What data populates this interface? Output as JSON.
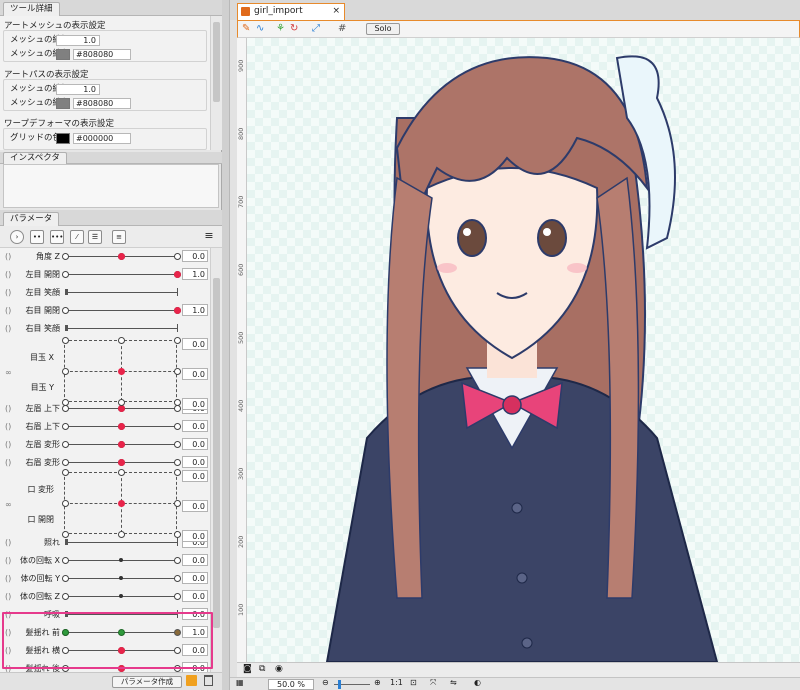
{
  "tool_details": {
    "tab": "ツール詳細",
    "sections": [
      {
        "title": "アートメッシュの表示設定",
        "rows": [
          {
            "label": "メッシュの線幅",
            "value": "1.0"
          },
          {
            "label": "メッシュの線色",
            "color": "#808080",
            "hex": "#808080"
          }
        ]
      },
      {
        "title": "アートパスの表示設定",
        "rows": [
          {
            "label": "メッシュの線幅",
            "value": "1.0"
          },
          {
            "label": "メッシュの線色",
            "color": "#808080",
            "hex": "#808080"
          }
        ]
      },
      {
        "title": "ワープデフォーマの表示設定",
        "rows": [
          {
            "label": "グリッドの色",
            "color": "#000000",
            "hex": "#000000"
          }
        ]
      }
    ]
  },
  "inspector": {
    "tab": "インスペクタ"
  },
  "parameter": {
    "tab": "パラメータ",
    "menu_icon": "hamburger-menu-icon",
    "create_button": "パラメータ作成",
    "rows": [
      {
        "name": "角度 Z",
        "value": "0.0",
        "pos": 0.5,
        "type": "red",
        "ticks": [
          0.5
        ]
      },
      {
        "name": "左目 開閉",
        "value": "1.0",
        "pos": 1.0,
        "type": "red",
        "ticks": []
      },
      {
        "name": "左目 笑顔",
        "value": "",
        "pos": 0,
        "type": "arrow",
        "ticks": []
      },
      {
        "name": "右目 開閉",
        "value": "1.0",
        "pos": 1.0,
        "type": "red",
        "ticks": []
      },
      {
        "name": "右目 笑顔",
        "value": "",
        "pos": 0,
        "type": "arrow",
        "ticks": []
      },
      {
        "name": "左眉 上下",
        "value": "0.0",
        "pos": 0.5,
        "type": "red",
        "ticks": [
          0.5
        ]
      },
      {
        "name": "右眉 上下",
        "value": "0.0",
        "pos": 0.5,
        "type": "red",
        "ticks": [
          0.5
        ]
      },
      {
        "name": "左眉 変形",
        "value": "0.0",
        "pos": 0.5,
        "type": "red",
        "ticks": [
          0.5
        ]
      },
      {
        "name": "右眉 変形",
        "value": "0.0",
        "pos": 0.5,
        "type": "red",
        "ticks": [
          0.5
        ]
      },
      {
        "name": "照れ",
        "value": "0.0",
        "pos": 0,
        "type": "arrow",
        "ticks": []
      },
      {
        "name": "体の回転 X",
        "value": "0.0",
        "pos": 0.5,
        "type": "small",
        "ticks": []
      },
      {
        "name": "体の回転 Y",
        "value": "0.0",
        "pos": 0.5,
        "type": "small",
        "ticks": []
      },
      {
        "name": "体の回転 Z",
        "value": "0.0",
        "pos": 0.5,
        "type": "small",
        "ticks": []
      },
      {
        "name": "呼吸",
        "value": "0.0",
        "pos": 0,
        "type": "arrow",
        "ticks": []
      },
      {
        "name": "髪揺れ 前",
        "value": "1.0",
        "pos": 0.5,
        "type": "green",
        "ticks": [
          0.5
        ]
      },
      {
        "name": "髪揺れ 横",
        "value": "0.0",
        "pos": 0.5,
        "type": "red",
        "ticks": [
          0.5
        ]
      },
      {
        "name": "髪揺れ 後",
        "value": "0.0",
        "pos": 0.5,
        "type": "red",
        "ticks": [
          0.5
        ]
      }
    ],
    "eye_group": {
      "x_label": "目玉 X",
      "y_label": "目玉 Y",
      "values": [
        "0.0",
        "0.0",
        "0.0"
      ]
    },
    "deform_group": {
      "x_label": "口 変形",
      "y_label": "口 開閉",
      "values": [
        "0.0",
        "0.0",
        "0.0"
      ]
    }
  },
  "document": {
    "tab_title": "girl_import",
    "solo_label": "Solo",
    "ruler_labels": [
      "900",
      "800",
      "700",
      "600",
      "500",
      "400",
      "300",
      "200",
      "100"
    ],
    "zoom": "50.0 %",
    "scale_label": "1:1"
  },
  "colors": {
    "accent_orange": "#e78a2c",
    "highlight_pink": "#e63a8c",
    "knob_red": "#e8244a"
  }
}
